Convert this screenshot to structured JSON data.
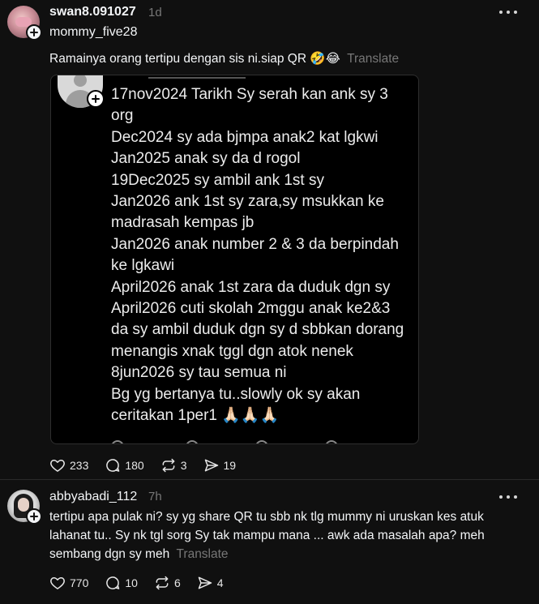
{
  "post1": {
    "username": "swan8.091027",
    "time": "1d",
    "mention": "mommy_five28",
    "text": "Ramainya orang tertipu dengan sis ni.siap QR 🤣😂",
    "translate_label": "Translate",
    "image_lines": [
      "17nov2024 Tarikh Sy serah kan ank sy 3 org",
      "Dec2024 sy ada bjmpa anak2 kat lgkwi",
      "Jan2025 anak sy da d rogol",
      "19Dec2025 sy ambil ank 1st sy",
      "Jan2026 ank 1st sy zara,sy msukkan ke madrasah kempas jb",
      "Jan2026 anak number 2 & 3 da berpindah ke lgkawi",
      "April2026 anak 1st zara da duduk dgn sy",
      "April2026 cuti skolah 2mggu anak ke2&3 da sy ambil duduk dgn sy d sbbkan dorang menangis xnak tggl dgn atok nenek",
      "8jun2026 sy tau semua ni",
      "Bg yg bertanya tu..slowly ok sy akan ceritakan 1per1 🙏🏻🙏🏻🙏🏻"
    ],
    "image_text": "17nov2024 Tarikh Sy serah kan ank sy 3\norg\nDec2024 sy ada bjmpa anak2 kat lgkwi\nJan2025 anak sy da d rogol\n19Dec2025 sy ambil ank 1st sy\nJan2026 ank 1st sy zara,sy msukkan ke\nmadrasah kempas jb\nJan2026 anak number 2 & 3 da berpindah\nke lgkawi\nApril2026 anak 1st zara da duduk dgn sy\nApril2026 cuti skolah 2mggu anak ke2&3\nda sy ambil duduk dgn sy d sbbkan dorang\nmenangis xnak tggl dgn atok nenek\n8jun2026 sy tau semua ni\nBg yg bertanya tu..slowly ok sy akan\nceritakan 1per1 🙏🏻🙏🏻🙏🏻",
    "likes": "233",
    "replies": "180",
    "reposts": "3",
    "shares": "19"
  },
  "post2": {
    "username": "abbyabadi_112",
    "time": "7h",
    "text": "tertipu apa pulak ni? sy yg share QR tu sbb nk tlg mummy ni uruskan kes atuk lahanat tu.. Sy nk tgl sorg Sy tak mampu mana ... awk ada masalah apa? meh sembang dgn sy meh",
    "translate_label": "Translate",
    "likes": "770",
    "replies": "10",
    "reposts": "6",
    "shares": "4"
  },
  "colors": {
    "background": "#101010",
    "text": "#f3f5f7",
    "muted": "#777777"
  }
}
